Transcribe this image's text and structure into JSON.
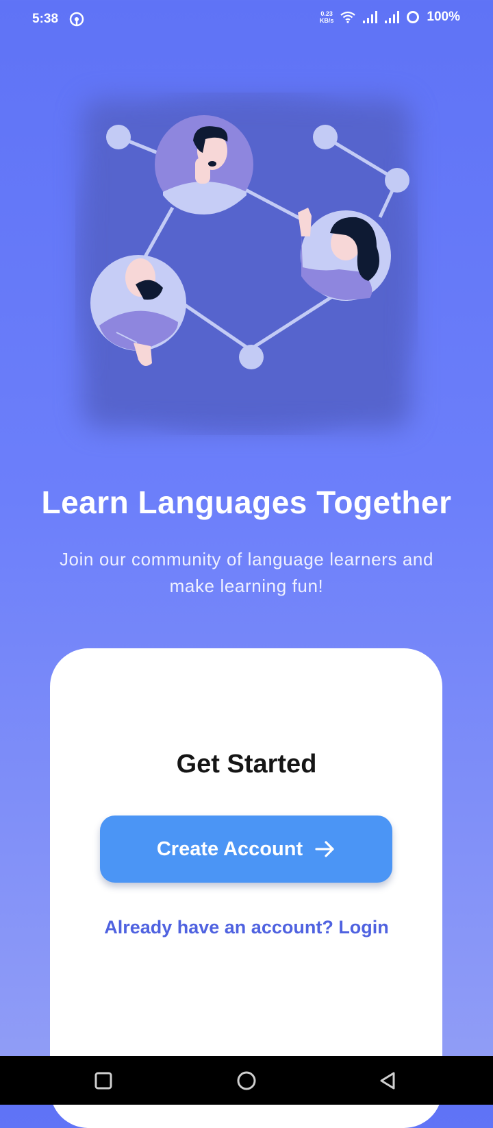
{
  "status_bar": {
    "time": "5:38",
    "net_speed_value": "0.23",
    "net_speed_unit": "KB/s",
    "battery": "100%"
  },
  "hero": {
    "title": "Learn Languages Together",
    "subtitle": "Join our community of language learners and make learning fun!"
  },
  "card": {
    "title": "Get Started",
    "create_account_label": "Create Account",
    "login_link_label": "Already have an account? Login"
  },
  "colors": {
    "background_top": "#5f73f6",
    "background_bottom": "#939ff6",
    "primary_button": "#4b95f5",
    "link": "#4f62e0"
  },
  "icons": {
    "create_account": "arrow-right-icon",
    "nav_recents": "square-icon",
    "nav_home": "circle-icon",
    "nav_back": "triangle-back-icon"
  }
}
